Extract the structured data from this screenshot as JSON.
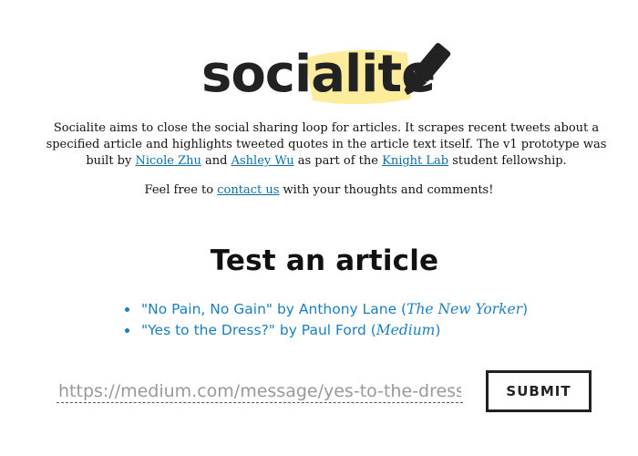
{
  "logo": {
    "text": "socialite",
    "highlight_color": "#fbe98a",
    "text_color": "#222222",
    "icon": "highlighter-pen-icon"
  },
  "intro": {
    "part1": "Socialite aims to close the social sharing loop for articles. It scrapes recent tweets about a specified article and highlights tweeted quotes in the article text itself. The v1 prototype was built by ",
    "author1_link": "Nicole Zhu",
    "part2": " and ",
    "author2_link": "Ashley Wu",
    "part3": " as part of the ",
    "lab_link": "Knight Lab",
    "part4": " student fellowship."
  },
  "contact": {
    "prefix": "Feel free to ",
    "link": "contact us",
    "suffix": " with your thoughts and comments!"
  },
  "test_section": {
    "title": "Test an article",
    "articles": [
      {
        "title": "\"No Pain, No Gain\" by Anthony Lane (",
        "publication": "The New Yorker",
        "close": ")"
      },
      {
        "title": "\"Yes to the Dress?\" by Paul Ford (",
        "publication": "Medium",
        "close": ")"
      }
    ]
  },
  "form": {
    "url_placeholder": "https://medium.com/message/yes-to-the-dress",
    "submit_label": "SUBMIT"
  },
  "colors": {
    "link": "#0a6ea8",
    "article_link": "#1a7fc1"
  }
}
